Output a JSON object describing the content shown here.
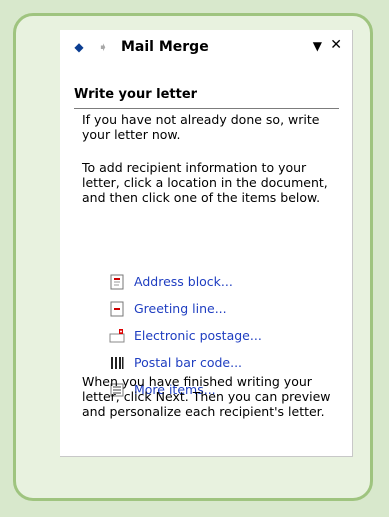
{
  "pane": {
    "title": "Mail Merge",
    "icons": {
      "back": "back-arrow-icon",
      "forward": "forward-arrow-icon",
      "dropdown": "dropdown-arrow-icon",
      "close": "close-icon"
    }
  },
  "section": {
    "heading": "Write your letter",
    "intro": "If you have not already done so, write your letter now.",
    "instructions": "To add recipient information to your letter, click a location in the document, and then click one of the items below.",
    "items": [
      {
        "label": "Address block...",
        "icon": "address-block-icon"
      },
      {
        "label": "Greeting line...",
        "icon": "greeting-line-icon"
      },
      {
        "label": "Electronic postage...",
        "icon": "electronic-postage-icon"
      },
      {
        "label": "Postal bar code...",
        "icon": "postal-bar-code-icon"
      },
      {
        "label": "More items...",
        "icon": "more-items-icon"
      }
    ],
    "footer": "When you have finished writing your letter, click Next. Then you can preview and personalize each recipient's letter."
  },
  "colors": {
    "background": "#d8e8cc",
    "frame_border": "#9fc47f",
    "link": "#1f3ec1"
  }
}
